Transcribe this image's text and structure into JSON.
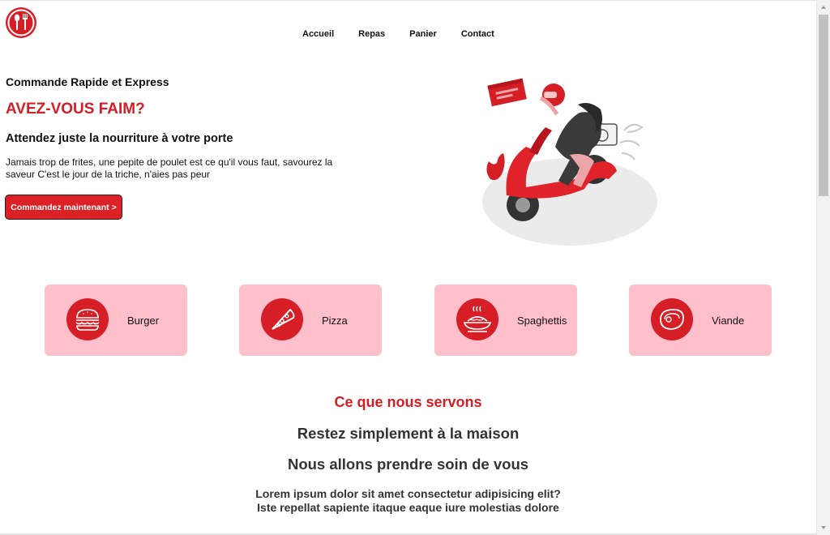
{
  "nav": {
    "items": [
      "Accueil",
      "Repas",
      "Panier",
      "Contact"
    ]
  },
  "hero": {
    "kicker": "Commande Rapide et Express",
    "title": "AVEZ-VOUS FAIM?",
    "subtitle": "Attendez juste la nourriture à votre porte",
    "description": "Jamais trop de frites, une pepite de poulet est ce qu'il vous faut, savourez la saveur C'est le jour de la triche, n'aies pas peur",
    "cta_label": "Commandez maintenant >"
  },
  "categories": [
    {
      "label": "Burger",
      "icon": "burger-icon"
    },
    {
      "label": "Pizza",
      "icon": "pizza-icon"
    },
    {
      "label": "Spaghettis",
      "icon": "spaghetti-icon"
    },
    {
      "label": "Viande",
      "icon": "meat-icon"
    }
  ],
  "serve": {
    "title": "Ce que nous servons",
    "heading1": "Restez simplement à la maison",
    "heading2": "Nous allons prendre soin de vous",
    "line1": "Lorem ipsum dolor sit amet consectetur adipisicing elit?",
    "line2": "Iste repellat sapiente itaque eaque iure molestias dolore"
  },
  "colors": {
    "accent": "#d41e26",
    "card_bg": "#ffc0cb",
    "button_bg": "#dc2126"
  }
}
